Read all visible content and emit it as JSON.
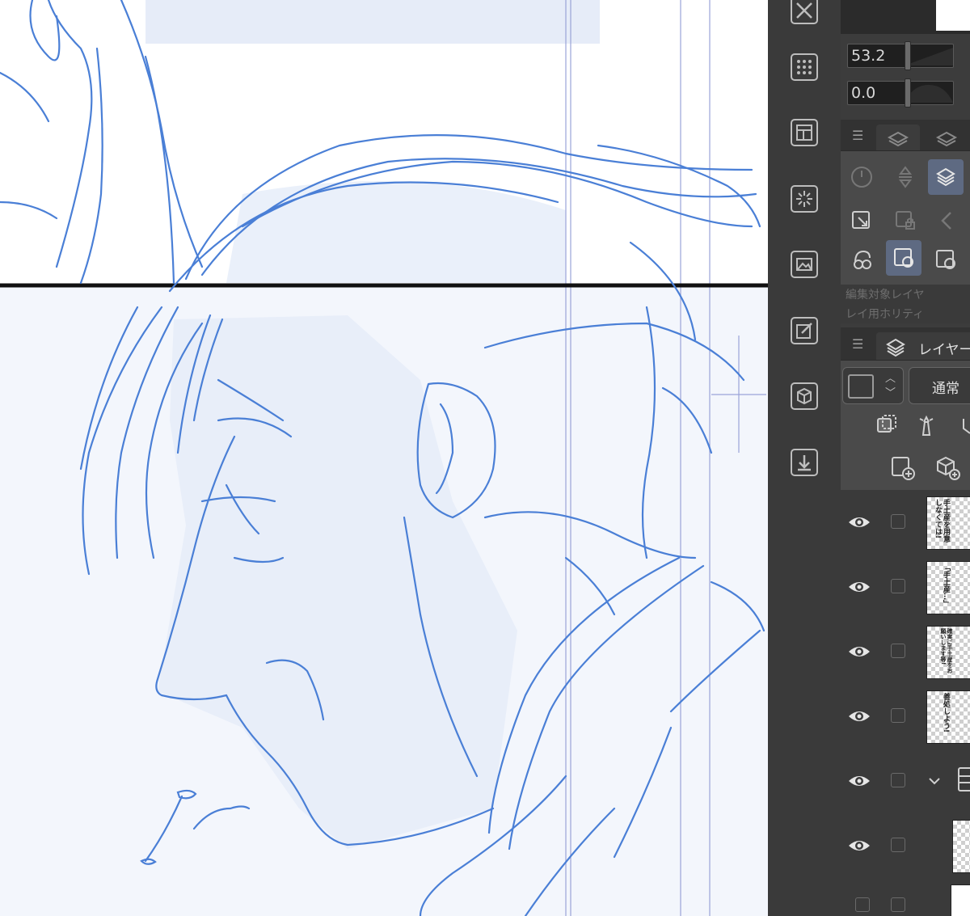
{
  "app": "Clip Studio Paint",
  "canvas": {
    "description_free": true,
    "stroke_color": "#4a7fd6",
    "panel_border_color": "#111111",
    "guide_color": "#9aa3d8"
  },
  "left_toolbar": {
    "icons": [
      "close-icon",
      "screentone-icon",
      "layout-icon",
      "transform-icon",
      "image-icon",
      "edit-icon",
      "3d-material-icon",
      "export-icon"
    ]
  },
  "brush_panel": {
    "size_value": "53.2",
    "opacity_value": "0.0",
    "size_level": 0.53,
    "opacity_level": 0.0
  },
  "layer_property": {
    "hint_line_1": "編集対象レイヤ",
    "hint_line_2": "レイ用ホリティ"
  },
  "layer_panel": {
    "tab_label": "レイヤー",
    "blend_mode": "通常",
    "layers": [
      {
        "text": "手土産を用意しなくては!",
        "visible": true
      },
      {
        "text": "「手土産…」",
        "visible": true
      },
      {
        "text": "確実に手土産をお願いします等!",
        "visible": true
      },
      {
        "text": "善処しよう!",
        "visible": true
      },
      {
        "text": "",
        "visible": true,
        "is_folder": true
      },
      {
        "text": "",
        "visible": true
      },
      {
        "text": "",
        "visible": false
      }
    ]
  },
  "colors": {
    "strip_bg": "#3a3a3a",
    "panel_bg": "#3c3c3c",
    "selected_tool": "#5e6a82",
    "icon": "#bdbdbd"
  }
}
